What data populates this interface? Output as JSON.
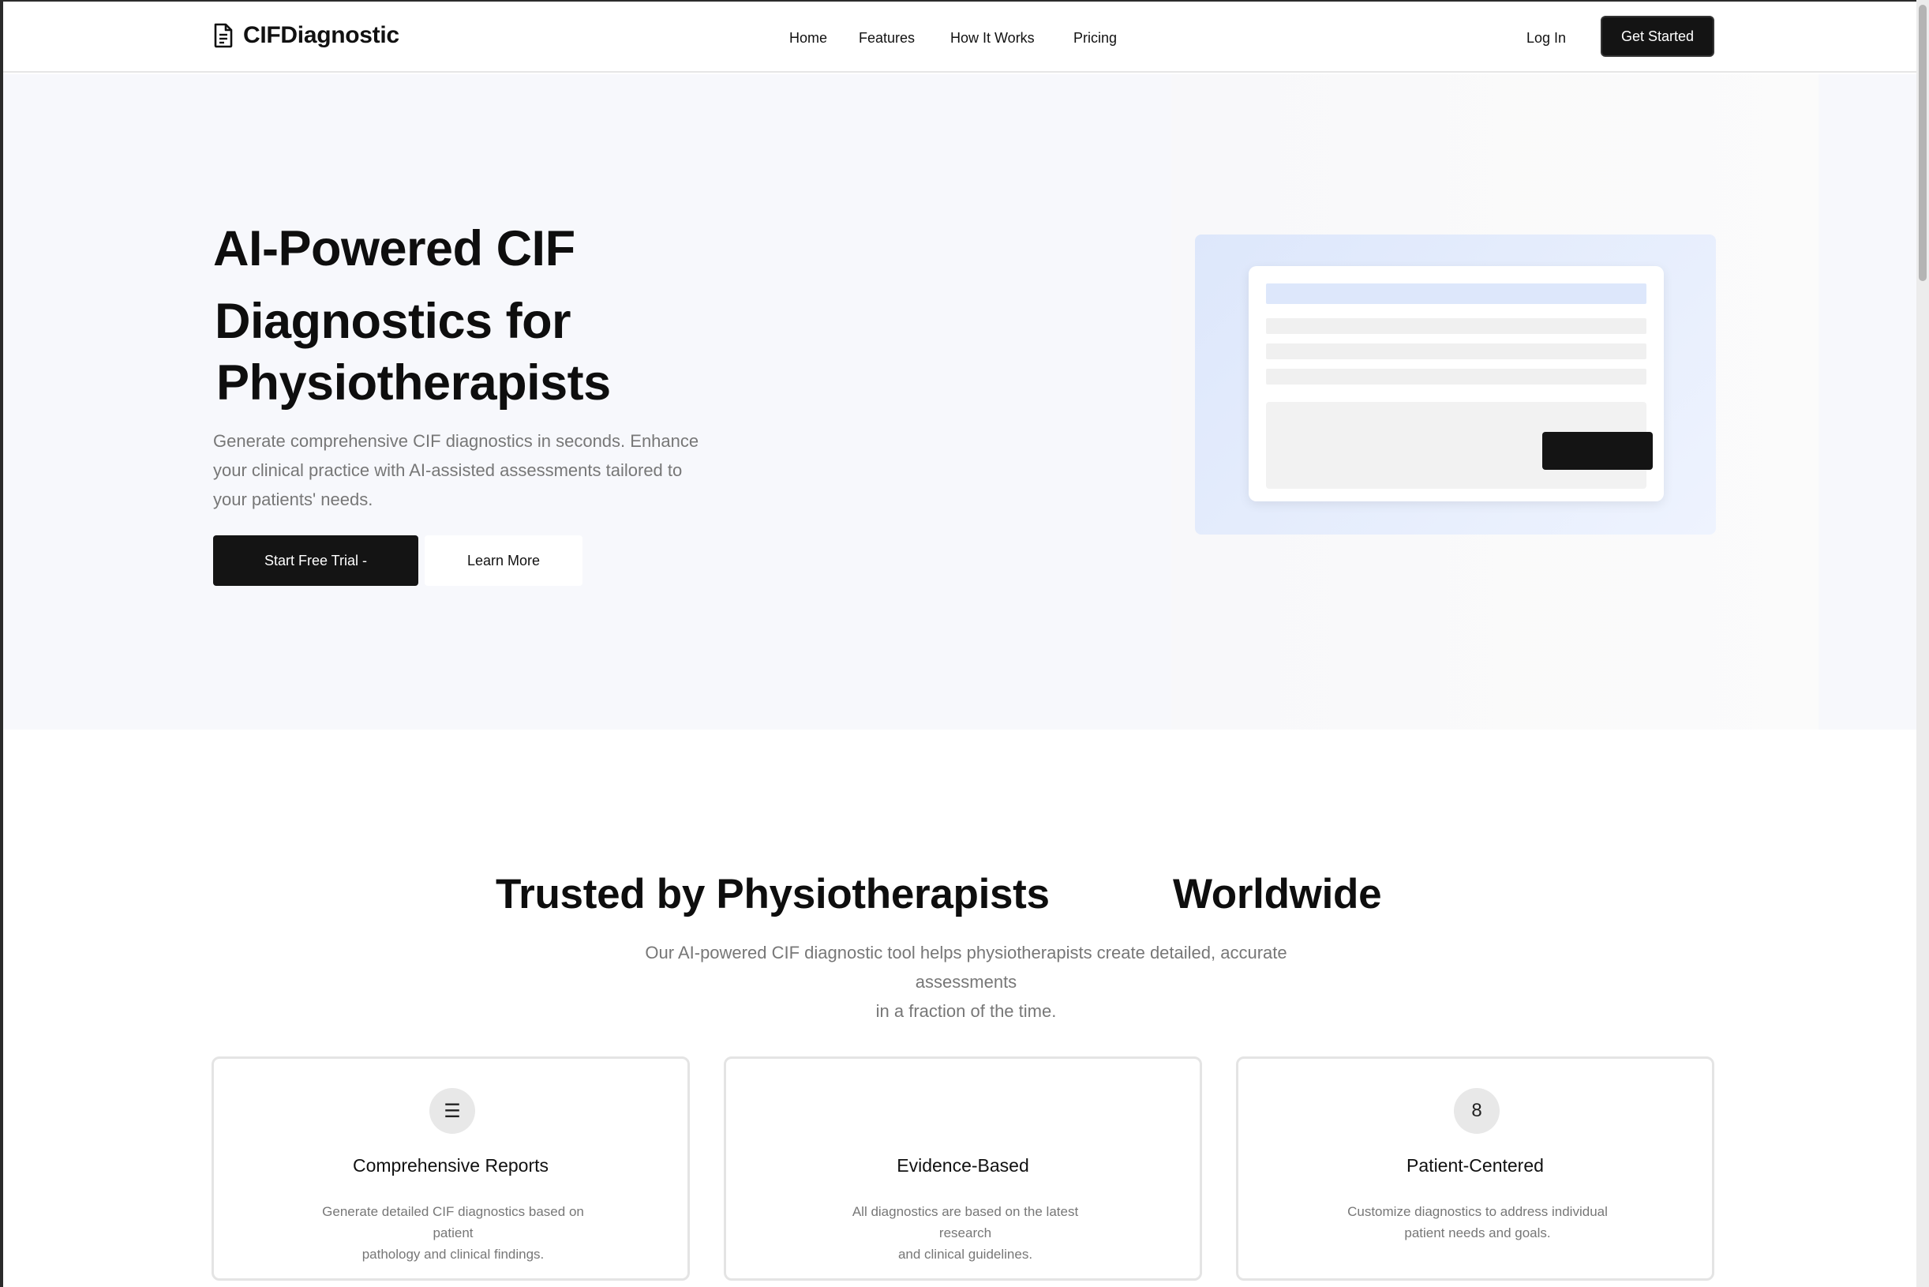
{
  "brand": {
    "name": "CIFDiagnostic",
    "logo_icon": "document-icon"
  },
  "nav": {
    "items": [
      "Home",
      "Features",
      "How It Works",
      "Pricing"
    ]
  },
  "header": {
    "login_label": "Log In",
    "cta_label": "Get Started"
  },
  "hero": {
    "title_lines": [
      "AI-Powered CIF",
      "Diagnostics for",
      "Physiotherapists"
    ],
    "subtitle_lines": [
      "Generate comprehensive CIF diagnostics in seconds. Enhance",
      "your clinical practice with AI-assisted assessments tailored to",
      "your patients' needs."
    ],
    "primary_cta": "Start Free Trial -",
    "secondary_cta": "Learn More"
  },
  "trusted": {
    "title_part1": "Trusted by Physiotherapists",
    "title_part2": "Worldwide",
    "subtitle_lines": [
      "Our AI-powered CIF diagnostic tool helps physiotherapists create detailed, accurate",
      "assessments",
      "in a fraction of the time."
    ]
  },
  "features": [
    {
      "icon": "report-list-icon",
      "icon_glyph": "☰",
      "title": "Comprehensive Reports",
      "desc_lines": [
        "Generate detailed CIF diagnostics based on",
        "patient",
        "pathology and clinical findings."
      ]
    },
    {
      "icon": "",
      "icon_glyph": "",
      "title": "Evidence-Based",
      "desc_lines": [
        "All diagnostics are based on the latest",
        "research",
        "and clinical guidelines."
      ]
    },
    {
      "icon": "patient-icon",
      "icon_glyph": "8",
      "title": "Patient-Centered",
      "desc_lines": [
        "Customize diagnostics to address individual",
        "patient needs and goals."
      ]
    }
  ],
  "colors": {
    "primary": "#141414",
    "hero_bg": "#f7f8fc",
    "mockup_accent": "#dbe6fb",
    "muted_text": "#777777"
  }
}
